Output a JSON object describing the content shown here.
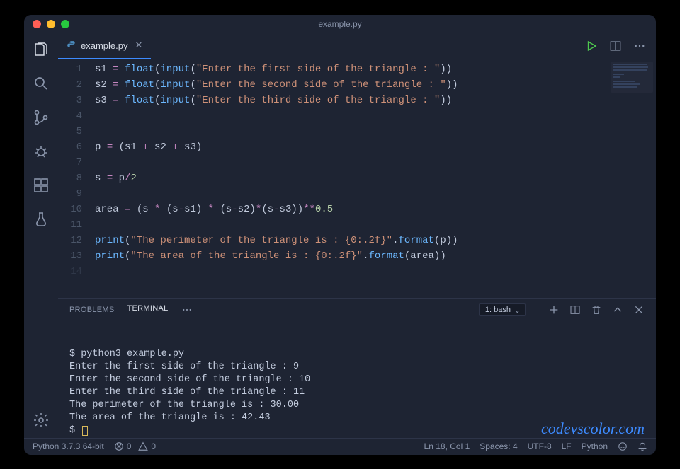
{
  "window": {
    "title": "example.py"
  },
  "tab": {
    "filename": "example.py"
  },
  "code_lines": [
    [
      [
        "id",
        "s1 "
      ],
      [
        "op",
        "="
      ],
      [
        "id",
        " "
      ],
      [
        "fn",
        "float"
      ],
      [
        "id",
        "("
      ],
      [
        "fn",
        "input"
      ],
      [
        "id",
        "("
      ],
      [
        "str",
        "\"Enter the first side of the triangle : \""
      ],
      [
        "id",
        "))"
      ]
    ],
    [
      [
        "id",
        "s2 "
      ],
      [
        "op",
        "="
      ],
      [
        "id",
        " "
      ],
      [
        "fn",
        "float"
      ],
      [
        "id",
        "("
      ],
      [
        "fn",
        "input"
      ],
      [
        "id",
        "("
      ],
      [
        "str",
        "\"Enter the second side of the triangle : \""
      ],
      [
        "id",
        "))"
      ]
    ],
    [
      [
        "id",
        "s3 "
      ],
      [
        "op",
        "="
      ],
      [
        "id",
        " "
      ],
      [
        "fn",
        "float"
      ],
      [
        "id",
        "("
      ],
      [
        "fn",
        "input"
      ],
      [
        "id",
        "("
      ],
      [
        "str",
        "\"Enter the third side of the triangle : \""
      ],
      [
        "id",
        "))"
      ]
    ],
    [],
    [],
    [
      [
        "id",
        "p "
      ],
      [
        "op",
        "="
      ],
      [
        "id",
        " (s1 "
      ],
      [
        "op",
        "+"
      ],
      [
        "id",
        " s2 "
      ],
      [
        "op",
        "+"
      ],
      [
        "id",
        " s3)"
      ]
    ],
    [],
    [
      [
        "id",
        "s "
      ],
      [
        "op",
        "="
      ],
      [
        "id",
        " p"
      ],
      [
        "op",
        "/"
      ],
      [
        "num",
        "2"
      ]
    ],
    [],
    [
      [
        "id",
        "area "
      ],
      [
        "op",
        "="
      ],
      [
        "id",
        " (s "
      ],
      [
        "op",
        "*"
      ],
      [
        "id",
        " (s"
      ],
      [
        "op",
        "-"
      ],
      [
        "id",
        "s1) "
      ],
      [
        "op",
        "*"
      ],
      [
        "id",
        " (s"
      ],
      [
        "op",
        "-"
      ],
      [
        "id",
        "s2)"
      ],
      [
        "op",
        "*"
      ],
      [
        "id",
        "(s"
      ],
      [
        "op",
        "-"
      ],
      [
        "id",
        "s3))"
      ],
      [
        "op",
        "**"
      ],
      [
        "num",
        "0.5"
      ]
    ],
    [],
    [
      [
        "fn",
        "print"
      ],
      [
        "id",
        "("
      ],
      [
        "str",
        "\"The perimeter of the triangle is : {0:.2f}\""
      ],
      [
        "id",
        "."
      ],
      [
        "fn",
        "format"
      ],
      [
        "id",
        "(p))"
      ]
    ],
    [
      [
        "fn",
        "print"
      ],
      [
        "id",
        "("
      ],
      [
        "str",
        "\"The area of the triangle is : {0:.2f}\""
      ],
      [
        "id",
        "."
      ],
      [
        "fn",
        "format"
      ],
      [
        "id",
        "(area))"
      ]
    ]
  ],
  "panel": {
    "tabs": {
      "problems": "PROBLEMS",
      "terminal": "TERMINAL"
    },
    "shell_label": "1: bash"
  },
  "terminal_lines": [
    "$ python3 example.py",
    "Enter the first side of the triangle : 9",
    "Enter the second side of the triangle : 10",
    "Enter the third side of the triangle : 11",
    "The perimeter of the triangle is : 30.00",
    "The area of the triangle is : 42.43",
    "$ "
  ],
  "watermark": "codevscolor.com",
  "status": {
    "interpreter": "Python 3.7.3 64-bit",
    "errors": "0",
    "warnings": "0",
    "cursor": "Ln 18, Col 1",
    "spaces": "Spaces: 4",
    "encoding": "UTF-8",
    "eol": "LF",
    "language": "Python"
  }
}
